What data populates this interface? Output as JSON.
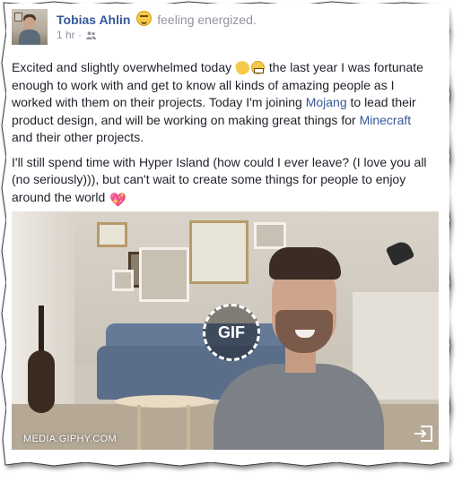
{
  "post": {
    "author": "Tobias Ahlin",
    "feeling": "feeling energized.",
    "time": "1 hr",
    "audience_separator": "·",
    "paragraph1": {
      "part1": "Excited and slightly overwhelmed today ",
      "part2": " the last year I was fortunate enough to work with and get to know all kinds of amazing people as I worked with them on their projects. Today I'm joining ",
      "link1": "Mojang",
      "part3": " to lead their product design, and will be working on making great things for ",
      "link2": "Minecraft",
      "part4": " and their other projects."
    },
    "paragraph2": {
      "part1": "I'll still spend time with Hyper Island (how could I ever leave? (I love you all (no seriously))), but can't wait to create some things for people to enjoy around the world ",
      "heart": "💖"
    }
  },
  "media": {
    "badge": "GIF",
    "source": "MEDIA.GIPHY.COM"
  },
  "icons": {
    "audience": "friends-icon",
    "open": "open-external-icon"
  },
  "colors": {
    "link": "#365899",
    "text": "#1d2129",
    "meta": "#90949c"
  }
}
